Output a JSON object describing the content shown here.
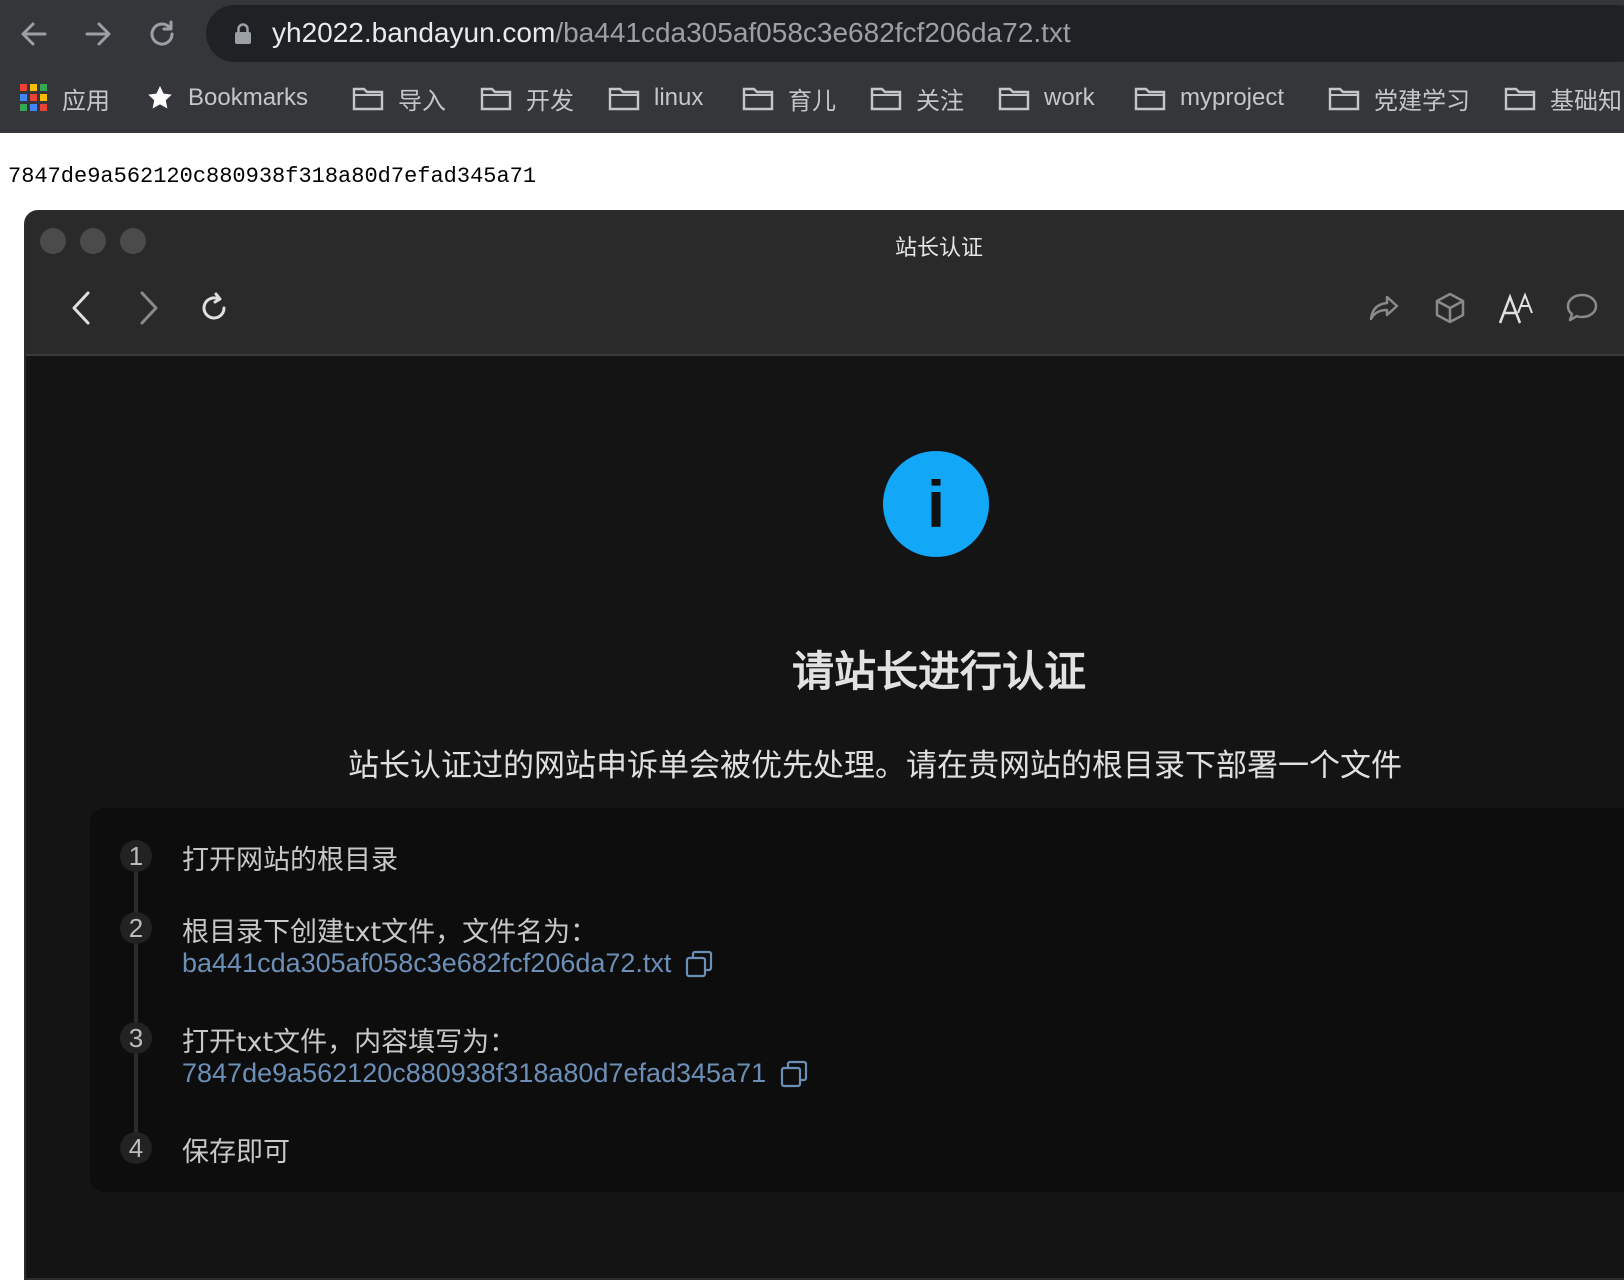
{
  "browser": {
    "url_host": "yh2022.bandayun.com",
    "url_path": "/ba441cda305af058c3e682fcf206da72.txt",
    "bookmarks": [
      {
        "label": "应用",
        "icon": "apps-grid-icon"
      },
      {
        "label": "Bookmarks",
        "icon": "star-icon"
      },
      {
        "label": "导入",
        "icon": "folder-icon"
      },
      {
        "label": "开发",
        "icon": "folder-icon"
      },
      {
        "label": "linux",
        "icon": "folder-icon"
      },
      {
        "label": "育儿",
        "icon": "folder-icon"
      },
      {
        "label": "关注",
        "icon": "folder-icon"
      },
      {
        "label": "work",
        "icon": "folder-icon"
      },
      {
        "label": "myproject",
        "icon": "folder-icon"
      },
      {
        "label": "党建学习",
        "icon": "folder-icon"
      },
      {
        "label": "基础知",
        "icon": "folder-icon"
      }
    ]
  },
  "file_content": "7847de9a562120c880938f318a80d7efad345a71",
  "window": {
    "title": "站长认证",
    "heading": "请站长进行认证",
    "description": "站长认证过的网站申诉单会被优先处理。请在贵网站的根目录下部署一个文件",
    "steps": [
      {
        "number": "1",
        "text": "打开网站的根目录"
      },
      {
        "number": "2",
        "text": "根目录下创建txt文件，文件名为：",
        "value": "ba441cda305af058c3e682fcf206da72.txt"
      },
      {
        "number": "3",
        "text": "打开txt文件，内容填写为：",
        "value": "7847de9a562120c880938f318a80d7efad345a71"
      },
      {
        "number": "4",
        "text": "保存即可"
      }
    ]
  },
  "colors": {
    "accent_info": "#13a8f7",
    "link": "#6c8fb8"
  }
}
